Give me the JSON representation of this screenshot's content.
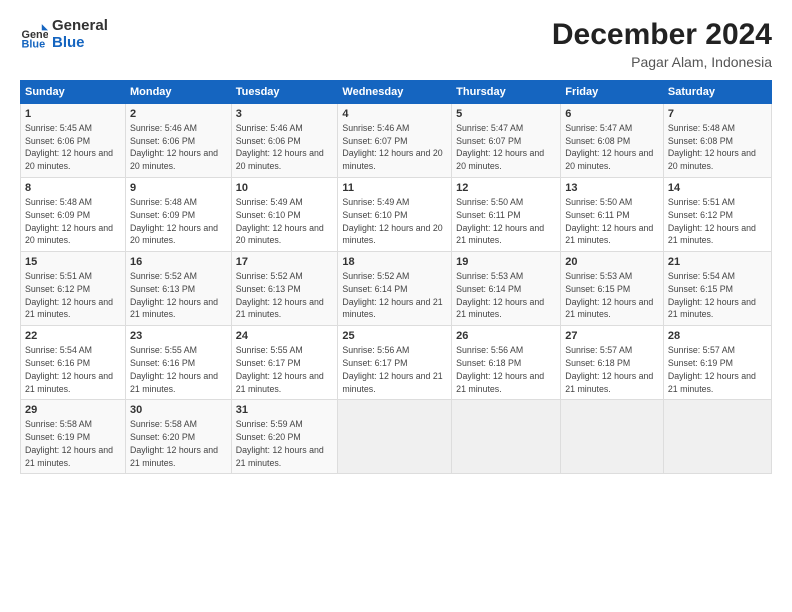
{
  "logo": {
    "general": "General",
    "blue": "Blue"
  },
  "title": "December 2024",
  "subtitle": "Pagar Alam, Indonesia",
  "columns": [
    "Sunday",
    "Monday",
    "Tuesday",
    "Wednesday",
    "Thursday",
    "Friday",
    "Saturday"
  ],
  "weeks": [
    [
      {
        "day": "1",
        "sunrise": "5:45 AM",
        "sunset": "6:06 PM",
        "daylight": "12 hours and 20 minutes."
      },
      {
        "day": "2",
        "sunrise": "5:46 AM",
        "sunset": "6:06 PM",
        "daylight": "12 hours and 20 minutes."
      },
      {
        "day": "3",
        "sunrise": "5:46 AM",
        "sunset": "6:06 PM",
        "daylight": "12 hours and 20 minutes."
      },
      {
        "day": "4",
        "sunrise": "5:46 AM",
        "sunset": "6:07 PM",
        "daylight": "12 hours and 20 minutes."
      },
      {
        "day": "5",
        "sunrise": "5:47 AM",
        "sunset": "6:07 PM",
        "daylight": "12 hours and 20 minutes."
      },
      {
        "day": "6",
        "sunrise": "5:47 AM",
        "sunset": "6:08 PM",
        "daylight": "12 hours and 20 minutes."
      },
      {
        "day": "7",
        "sunrise": "5:48 AM",
        "sunset": "6:08 PM",
        "daylight": "12 hours and 20 minutes."
      }
    ],
    [
      {
        "day": "8",
        "sunrise": "5:48 AM",
        "sunset": "6:09 PM",
        "daylight": "12 hours and 20 minutes."
      },
      {
        "day": "9",
        "sunrise": "5:48 AM",
        "sunset": "6:09 PM",
        "daylight": "12 hours and 20 minutes."
      },
      {
        "day": "10",
        "sunrise": "5:49 AM",
        "sunset": "6:10 PM",
        "daylight": "12 hours and 20 minutes."
      },
      {
        "day": "11",
        "sunrise": "5:49 AM",
        "sunset": "6:10 PM",
        "daylight": "12 hours and 20 minutes."
      },
      {
        "day": "12",
        "sunrise": "5:50 AM",
        "sunset": "6:11 PM",
        "daylight": "12 hours and 21 minutes."
      },
      {
        "day": "13",
        "sunrise": "5:50 AM",
        "sunset": "6:11 PM",
        "daylight": "12 hours and 21 minutes."
      },
      {
        "day": "14",
        "sunrise": "5:51 AM",
        "sunset": "6:12 PM",
        "daylight": "12 hours and 21 minutes."
      }
    ],
    [
      {
        "day": "15",
        "sunrise": "5:51 AM",
        "sunset": "6:12 PM",
        "daylight": "12 hours and 21 minutes."
      },
      {
        "day": "16",
        "sunrise": "5:52 AM",
        "sunset": "6:13 PM",
        "daylight": "12 hours and 21 minutes."
      },
      {
        "day": "17",
        "sunrise": "5:52 AM",
        "sunset": "6:13 PM",
        "daylight": "12 hours and 21 minutes."
      },
      {
        "day": "18",
        "sunrise": "5:52 AM",
        "sunset": "6:14 PM",
        "daylight": "12 hours and 21 minutes."
      },
      {
        "day": "19",
        "sunrise": "5:53 AM",
        "sunset": "6:14 PM",
        "daylight": "12 hours and 21 minutes."
      },
      {
        "day": "20",
        "sunrise": "5:53 AM",
        "sunset": "6:15 PM",
        "daylight": "12 hours and 21 minutes."
      },
      {
        "day": "21",
        "sunrise": "5:54 AM",
        "sunset": "6:15 PM",
        "daylight": "12 hours and 21 minutes."
      }
    ],
    [
      {
        "day": "22",
        "sunrise": "5:54 AM",
        "sunset": "6:16 PM",
        "daylight": "12 hours and 21 minutes."
      },
      {
        "day": "23",
        "sunrise": "5:55 AM",
        "sunset": "6:16 PM",
        "daylight": "12 hours and 21 minutes."
      },
      {
        "day": "24",
        "sunrise": "5:55 AM",
        "sunset": "6:17 PM",
        "daylight": "12 hours and 21 minutes."
      },
      {
        "day": "25",
        "sunrise": "5:56 AM",
        "sunset": "6:17 PM",
        "daylight": "12 hours and 21 minutes."
      },
      {
        "day": "26",
        "sunrise": "5:56 AM",
        "sunset": "6:18 PM",
        "daylight": "12 hours and 21 minutes."
      },
      {
        "day": "27",
        "sunrise": "5:57 AM",
        "sunset": "6:18 PM",
        "daylight": "12 hours and 21 minutes."
      },
      {
        "day": "28",
        "sunrise": "5:57 AM",
        "sunset": "6:19 PM",
        "daylight": "12 hours and 21 minutes."
      }
    ],
    [
      {
        "day": "29",
        "sunrise": "5:58 AM",
        "sunset": "6:19 PM",
        "daylight": "12 hours and 21 minutes."
      },
      {
        "day": "30",
        "sunrise": "5:58 AM",
        "sunset": "6:20 PM",
        "daylight": "12 hours and 21 minutes."
      },
      {
        "day": "31",
        "sunrise": "5:59 AM",
        "sunset": "6:20 PM",
        "daylight": "12 hours and 21 minutes."
      },
      null,
      null,
      null,
      null
    ]
  ],
  "labels": {
    "sunrise": "Sunrise:",
    "sunset": "Sunset:",
    "daylight": "Daylight:"
  }
}
